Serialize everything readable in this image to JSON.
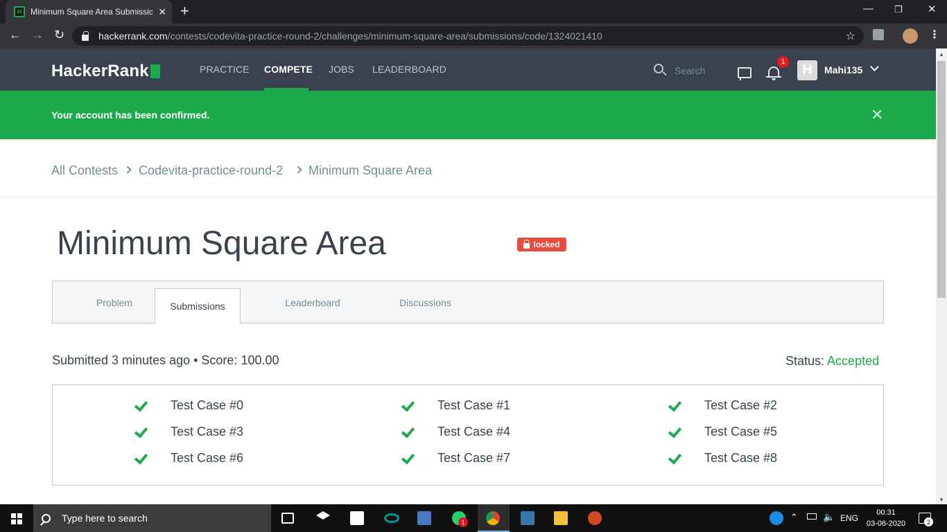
{
  "browser": {
    "tab_title": "Minimum Square Area Submissio",
    "url_host": "hackerrank.com",
    "url_path": "/contests/codevita-practice-round-2/challenges/minimum-square-area/submissions/code/1324021410"
  },
  "nav": {
    "logo": "HackerRank",
    "links": [
      "PRACTICE",
      "COMPETE",
      "JOBS",
      "LEADERBOARD"
    ],
    "active": "COMPETE",
    "search_placeholder": "Search",
    "notification_count": "1",
    "avatar_letter": "H",
    "username": "Mahi135"
  },
  "banner": {
    "message": "Your account has been confirmed.",
    "close": "✕"
  },
  "breadcrumb": [
    "All Contests",
    "Codevita-practice-round-2",
    "Minimum Square Area"
  ],
  "challenge": {
    "title": "Minimum Square Area",
    "badge": "locked",
    "tabs": [
      "Problem",
      "Submissions",
      "Leaderboard",
      "Discussions"
    ],
    "active_tab": "Submissions"
  },
  "submission": {
    "summary": "Submitted 3 minutes ago • Score: 100.00",
    "status_label": "Status: ",
    "status_value": "Accepted",
    "test_cases": [
      "Test Case #0",
      "Test Case #1",
      "Test Case #2",
      "Test Case #3",
      "Test Case #4",
      "Test Case #5",
      "Test Case #6",
      "Test Case #7",
      "Test Case #8"
    ]
  },
  "taskbar": {
    "search_placeholder": "Type here to search",
    "whatsapp_badge": "1",
    "language": "ENG",
    "time": "00:31",
    "date": "03-06-2020",
    "notifications": "2"
  },
  "colors": {
    "brand_green": "#1ba94c",
    "nav_bg": "#39424e",
    "locked_red": "#e74c3c"
  }
}
